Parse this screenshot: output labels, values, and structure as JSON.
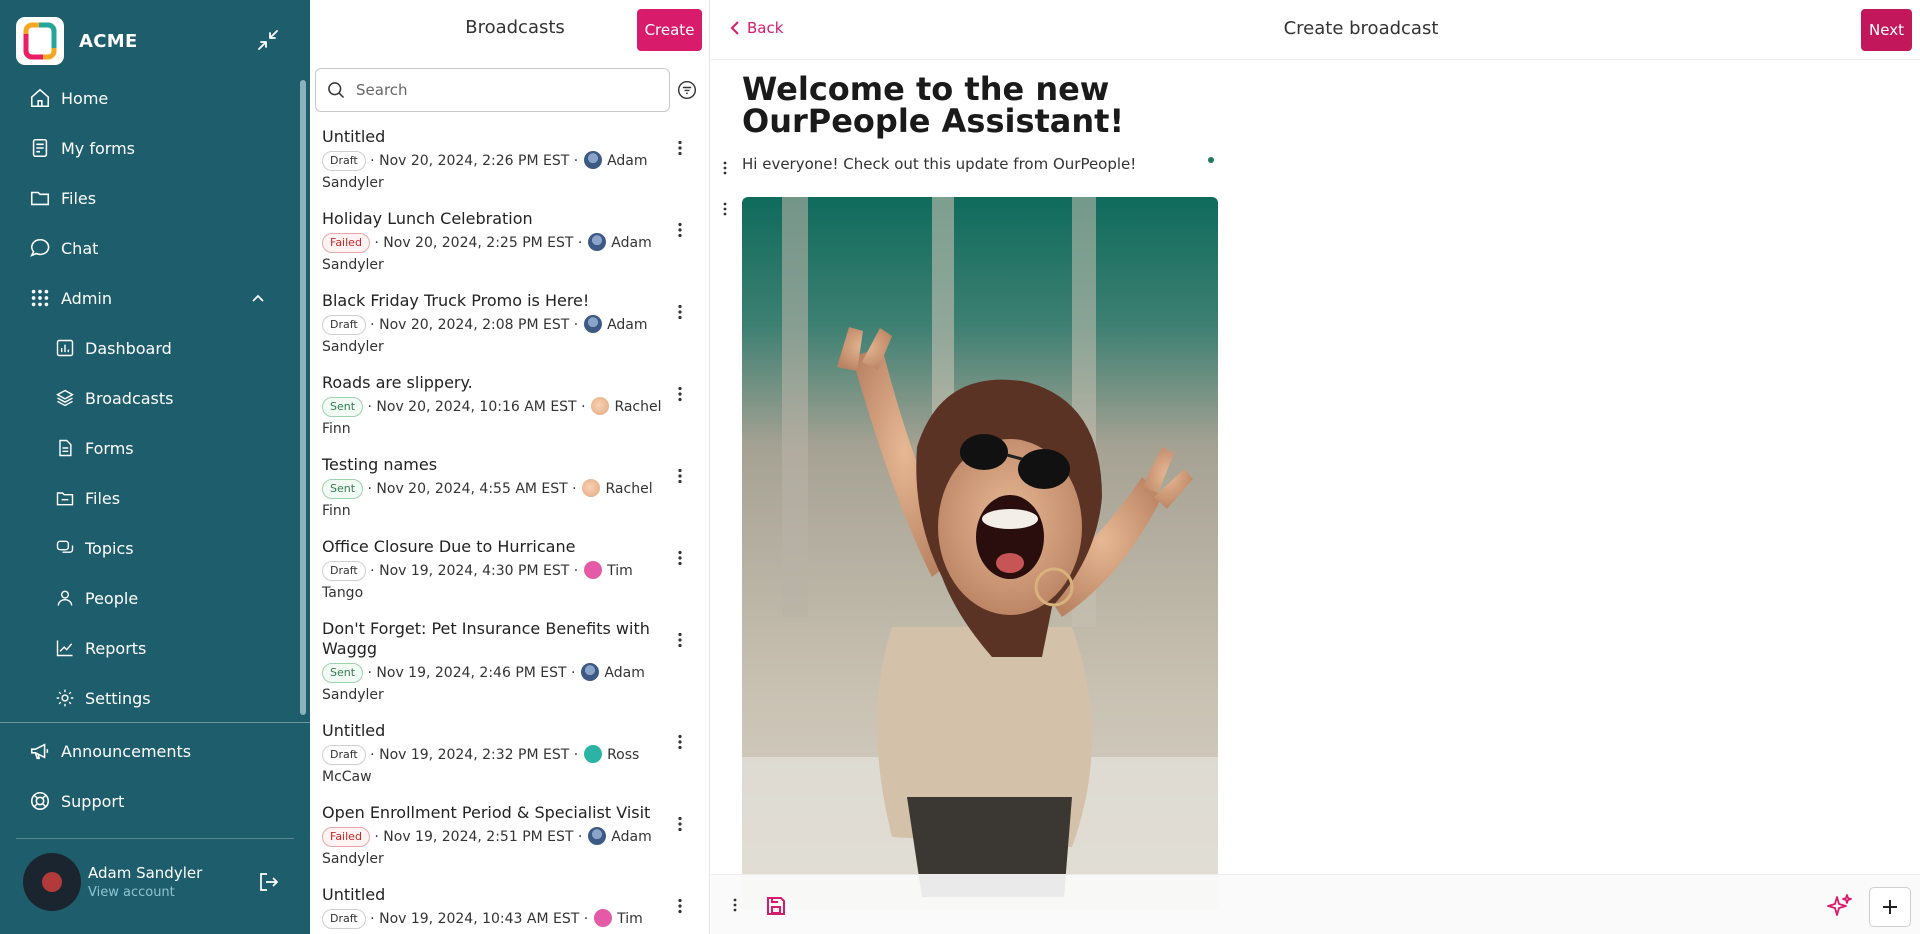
{
  "brand": {
    "name": "ACME"
  },
  "sidebar": {
    "nav": [
      {
        "label": "Home",
        "icon": "home-icon"
      },
      {
        "label": "My forms",
        "icon": "form-icon"
      },
      {
        "label": "Files",
        "icon": "folder-icon"
      },
      {
        "label": "Chat",
        "icon": "chat-icon"
      },
      {
        "label": "Admin",
        "icon": "grid-icon"
      }
    ],
    "admin_items": [
      {
        "label": "Dashboard",
        "icon": "chart-icon"
      },
      {
        "label": "Broadcasts",
        "icon": "layers-icon"
      },
      {
        "label": "Forms",
        "icon": "document-icon"
      },
      {
        "label": "Files",
        "icon": "files-icon"
      },
      {
        "label": "Topics",
        "icon": "topics-icon"
      },
      {
        "label": "People",
        "icon": "person-icon"
      },
      {
        "label": "Reports",
        "icon": "trend-icon"
      },
      {
        "label": "Settings",
        "icon": "gear-icon"
      }
    ],
    "bottom": [
      {
        "label": "Announcements",
        "icon": "megaphone-icon"
      },
      {
        "label": "Support",
        "icon": "lifebuoy-icon"
      }
    ],
    "account": {
      "name": "Adam Sandyler",
      "link": "View account"
    }
  },
  "list": {
    "title": "Broadcasts",
    "create_label": "Create",
    "search_placeholder": "Search",
    "items": [
      {
        "title": "Untitled",
        "status": "Draft",
        "date": "Nov 20, 2024, 2:26 PM EST",
        "author_first": "Adam",
        "author_last": "Sandyler"
      },
      {
        "title": "Holiday Lunch Celebration",
        "status": "Failed",
        "date": "Nov 20, 2024, 2:25 PM EST",
        "author_first": "Adam",
        "author_last": "Sandyler"
      },
      {
        "title": "Black Friday Truck Promo is Here!",
        "status": "Draft",
        "date": "Nov 20, 2024, 2:08 PM EST",
        "author_first": "Adam",
        "author_last": "Sandyler"
      },
      {
        "title": "Roads are slippery.",
        "status": "Sent",
        "date": "Nov 20, 2024, 10:16 AM EST",
        "author_first": "Rachel",
        "author_last": "Finn"
      },
      {
        "title": "Testing names",
        "status": "Sent",
        "date": "Nov 20, 2024, 4:55 AM EST",
        "author_first": "Rachel",
        "author_last": "Finn"
      },
      {
        "title": "Office Closure Due to Hurricane",
        "status": "Draft",
        "date": "Nov 19, 2024, 4:30 PM EST",
        "author_first": "Tim",
        "author_last": "Tango"
      },
      {
        "title": "Don't Forget: Pet Insurance Benefits with Waggg",
        "status": "Sent",
        "date": "Nov 19, 2024, 2:46 PM EST",
        "author_first": "Adam",
        "author_last": "Sandyler"
      },
      {
        "title": "Untitled",
        "status": "Draft",
        "date": "Nov 19, 2024, 2:32 PM EST",
        "author_first": "Ross",
        "author_last": "McCaw"
      },
      {
        "title": "Open Enrollment Period & Specialist Visit",
        "status": "Failed",
        "date": "Nov 19, 2024, 2:51 PM EST",
        "author_first": "Adam",
        "author_last": "Sandyler"
      },
      {
        "title": "Untitled",
        "status": "Draft",
        "date": "Nov 19, 2024, 10:43 AM EST",
        "author_first": "Tim",
        "author_last": ""
      }
    ]
  },
  "editor": {
    "back_label": "Back",
    "title": "Create broadcast",
    "next_label": "Next",
    "doc_title": "Welcome to the new OurPeople Assistant!",
    "doc_intro": "Hi everyone! Check out this update from OurPeople!"
  },
  "colors": {
    "sidebar": "#1d5d6c",
    "accent": "#d81b6b",
    "failed": "#c62828",
    "sent": "#2e7d4f"
  }
}
